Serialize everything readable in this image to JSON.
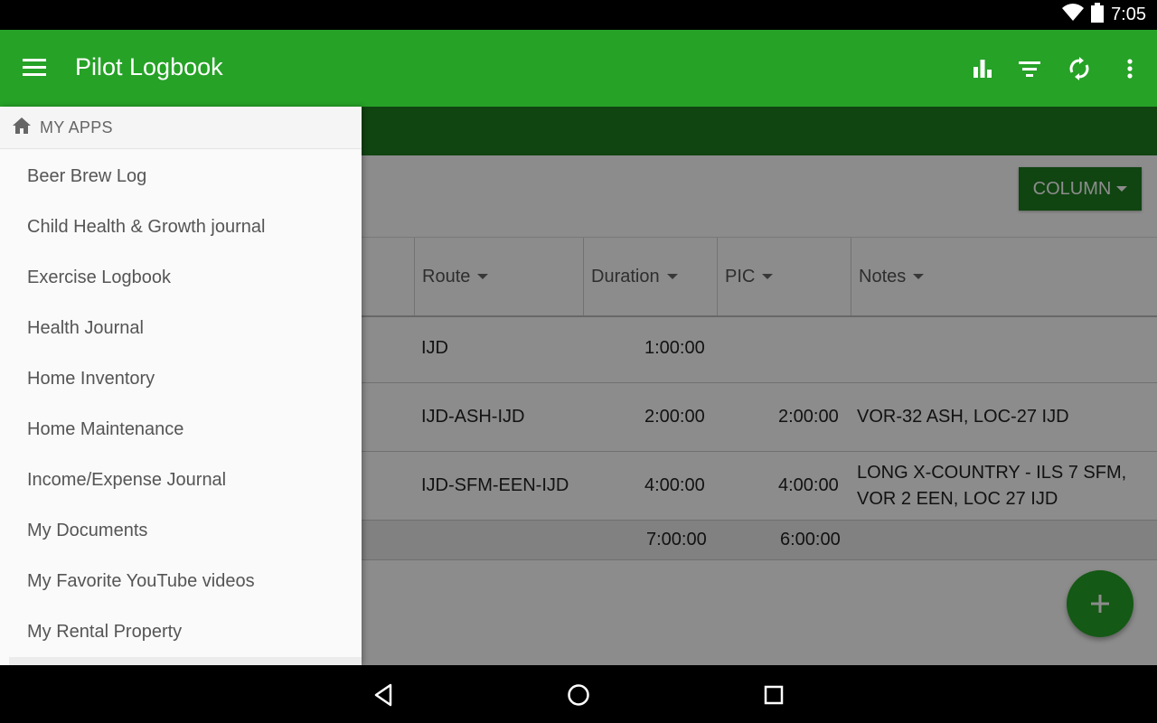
{
  "status_bar": {
    "time": "7:05",
    "icons": [
      "wifi-icon",
      "battery-icon"
    ]
  },
  "app_bar": {
    "title": "Pilot Logbook",
    "actions": [
      "chart-icon",
      "filter-icon",
      "sync-icon",
      "more-vert-icon"
    ]
  },
  "toolbar": {
    "column_button": "COLUMN"
  },
  "table": {
    "headers": [
      "Route",
      "Duration",
      "PIC",
      "Notes"
    ],
    "rows": [
      {
        "route": "IJD",
        "duration": "1:00:00",
        "pic": "",
        "notes_1": "",
        "notes_2": ""
      },
      {
        "route": "IJD-ASH-IJD",
        "duration": "2:00:00",
        "pic": "2:00:00",
        "notes_1": "VOR-32 ASH, LOC-27 IJD",
        "notes_2": ""
      },
      {
        "route": "IJD-SFM-EEN-IJD",
        "duration": "4:00:00",
        "pic": "4:00:00",
        "notes_1": "LONG X-COUNTRY - ILS 7 SFM,",
        "notes_2": "VOR 2 EEN, LOC 27 IJD"
      }
    ],
    "totals": {
      "duration": "7:00:00",
      "pic": "6:00:00"
    }
  },
  "fab": {
    "icon": "add-icon"
  },
  "drawer": {
    "header": "MY APPS",
    "items": [
      "Beer Brew Log",
      "Child Health & Growth journal",
      "Exercise Logbook",
      "Health Journal",
      "Home Inventory",
      "Home Maintenance",
      "Income/Expense Journal",
      "My Documents",
      "My Favorite YouTube videos",
      "My Rental Property"
    ]
  },
  "colors": {
    "primary": "#26a227",
    "primary_dark": "#1e7d1f"
  },
  "nav_bar": {
    "icons": [
      "back-icon",
      "home-icon",
      "recents-icon"
    ]
  }
}
